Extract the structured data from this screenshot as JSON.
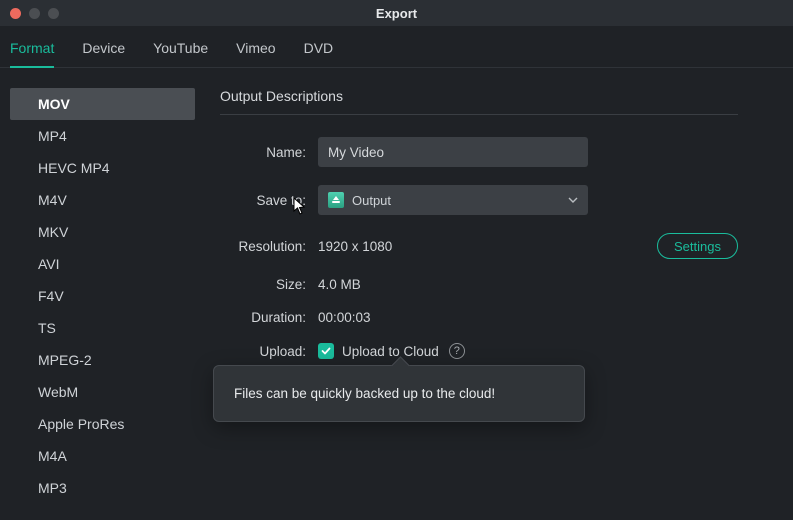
{
  "window": {
    "title": "Export"
  },
  "tabs": [
    {
      "label": "Format",
      "active": true
    },
    {
      "label": "Device"
    },
    {
      "label": "YouTube"
    },
    {
      "label": "Vimeo"
    },
    {
      "label": "DVD"
    }
  ],
  "formats": [
    {
      "label": "MOV",
      "active": true
    },
    {
      "label": "MP4"
    },
    {
      "label": "HEVC MP4"
    },
    {
      "label": "M4V"
    },
    {
      "label": "MKV"
    },
    {
      "label": "AVI"
    },
    {
      "label": "F4V"
    },
    {
      "label": "TS"
    },
    {
      "label": "MPEG-2"
    },
    {
      "label": "WebM"
    },
    {
      "label": "Apple ProRes"
    },
    {
      "label": "M4A"
    },
    {
      "label": "MP3"
    }
  ],
  "pane": {
    "heading": "Output Descriptions",
    "fields": {
      "name_label": "Name:",
      "name_value": "My Video",
      "saveto_label": "Save to:",
      "saveto_value": "Output",
      "resolution_label": "Resolution:",
      "resolution_value": "1920 x 1080",
      "settings_label": "Settings",
      "size_label": "Size:",
      "size_value": "4.0 MB",
      "duration_label": "Duration:",
      "duration_value": "00:00:03",
      "upload_label": "Upload:",
      "upload_checkbox_label": "Upload to Cloud",
      "upload_checked": true
    }
  },
  "tooltip": "Files can be quickly backed up to the cloud!"
}
